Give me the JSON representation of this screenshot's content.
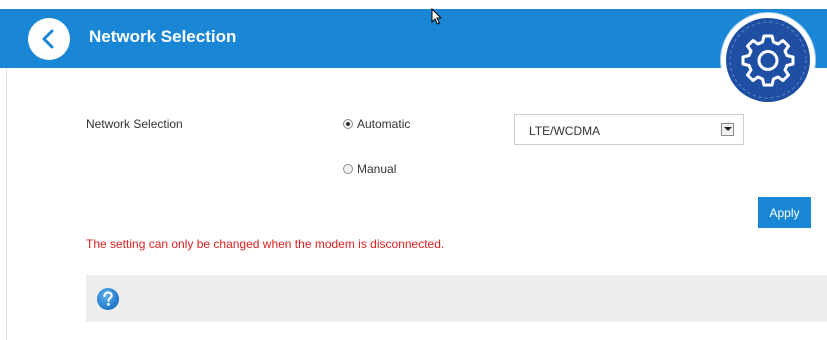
{
  "header": {
    "title": "Network Selection",
    "background_color": "#1a87d6",
    "back_icon": "chevron-left-icon",
    "settings_icon": "gear-icon"
  },
  "form": {
    "label": "Network Selection",
    "mode_options": [
      {
        "label": "Automatic",
        "checked": true
      },
      {
        "label": "Manual",
        "checked": false
      }
    ],
    "network_type": {
      "selected": "LTE/WCDMA"
    },
    "apply_label": "Apply",
    "apply_color": "#1a87d6"
  },
  "warning": {
    "text": "The setting can only be changed when the modem is disconnected.",
    "color": "#e02020"
  },
  "help": {
    "icon": "question-icon",
    "color": "#1a87d6"
  }
}
